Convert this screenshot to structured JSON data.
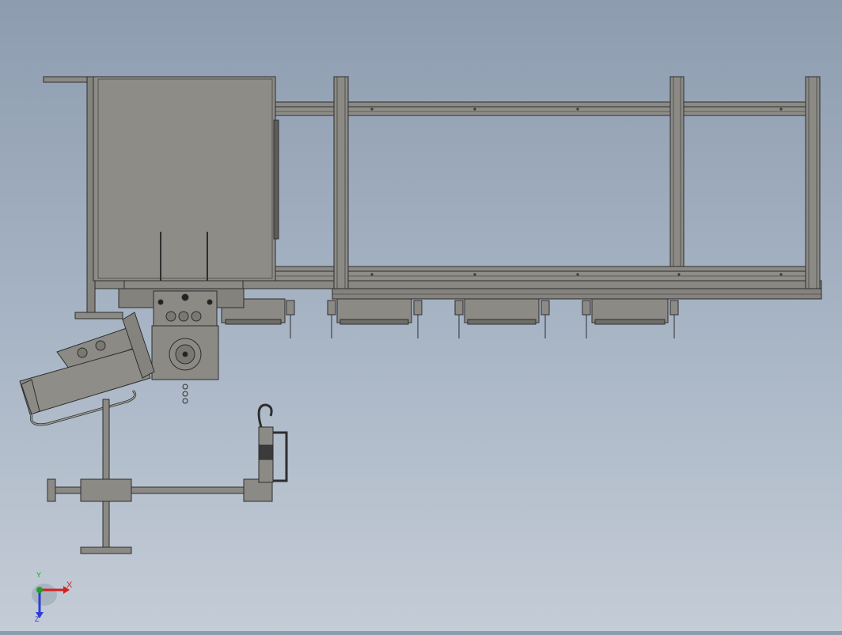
{
  "view": {
    "background_top": "#8d9caf",
    "background_bottom": "#c4ccd6",
    "part_fill": "#8c8a85",
    "part_dark": "#6f6d68",
    "outline": "#2e2e2e"
  },
  "triad": {
    "x_label": "X",
    "y_label": "Y",
    "z_label": "Z",
    "x_color": "#d42020",
    "y_color": "#1fa02a",
    "z_color": "#2b3fd8"
  }
}
